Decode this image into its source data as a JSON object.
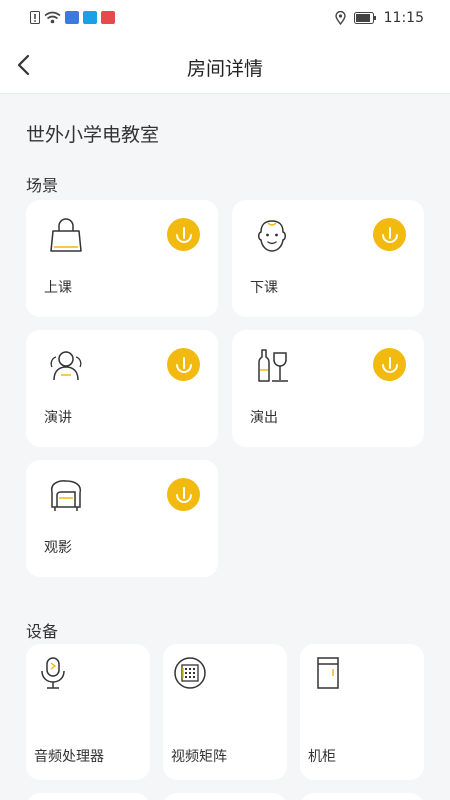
{
  "status_bar": {
    "time": "11:15",
    "notif_colors": [
      "#3b7be0",
      "#1aa0e6",
      "#e64b4b"
    ]
  },
  "header": {
    "title": "房间详情"
  },
  "room": {
    "name": "世外小学电教室"
  },
  "scenes": {
    "section_label": "场景",
    "accent_color": "#f2b90f",
    "items": [
      {
        "label": "上课",
        "icon": "bag-icon"
      },
      {
        "label": "下课",
        "icon": "face-icon"
      },
      {
        "label": "演讲",
        "icon": "audience-icon"
      },
      {
        "label": "演出",
        "icon": "wine-icon"
      },
      {
        "label": "观影",
        "icon": "armchair-icon"
      }
    ]
  },
  "devices": {
    "section_label": "设备",
    "items": [
      {
        "label": "音频处理器",
        "icon": "microphone-icon"
      },
      {
        "label": "视频矩阵",
        "icon": "matrix-icon"
      },
      {
        "label": "机柜",
        "icon": "cabinet-icon"
      }
    ]
  }
}
